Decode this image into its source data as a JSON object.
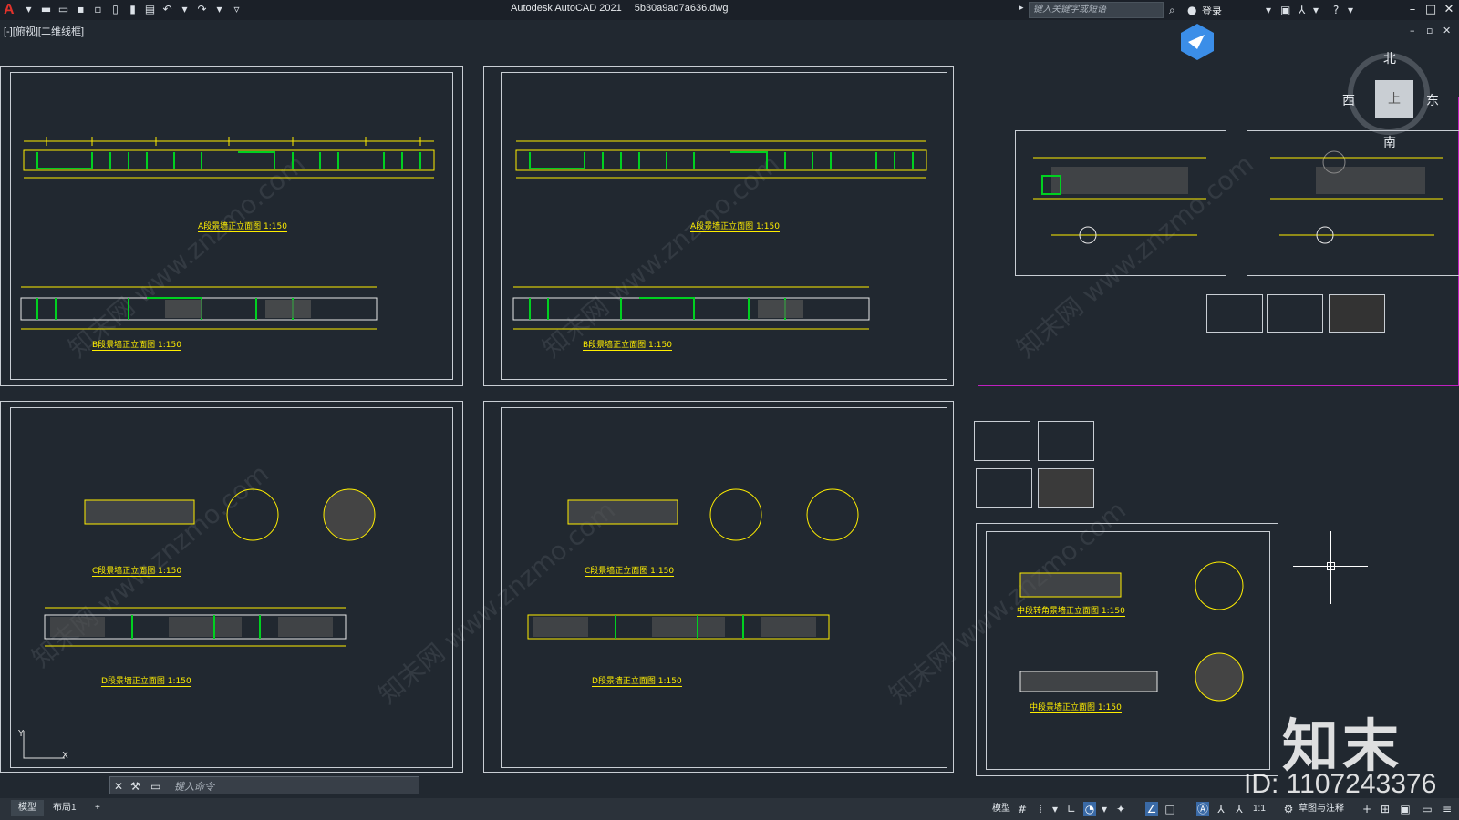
{
  "app": {
    "title": "Autodesk AutoCAD 2021",
    "filename": "5b30a9ad7a636.dwg",
    "search_placeholder": "键入关键字或短语",
    "login": "登录",
    "viewport_label": "[-][俯视][二维线框]"
  },
  "viewcube": {
    "face": "上",
    "north": "北",
    "south": "南",
    "east": "东",
    "west": "西"
  },
  "sheets": {
    "captions": [
      "A段景墙正立面图 1:150",
      "B段景墙正立面图 1:150",
      "A段景墙正立面图 1:150",
      "B段景墙正立面图 1:150",
      "C段景墙正立面图 1:150",
      "D段景墙正立面图 1:150",
      "C段景墙正立面图 1:150",
      "D段景墙正立面图 1:150",
      "中段转角景墙正立面图 1:150",
      "中段景墙正立面图 1:150"
    ]
  },
  "command": {
    "placeholder": "键入命令"
  },
  "tabs": [
    "模型",
    "布局1",
    "+"
  ],
  "status": {
    "model": "模型",
    "scale": "1:1",
    "workspace": "草图与注释"
  },
  "watermark": {
    "text": "知末网 www.znzmo.com",
    "brand": "知末",
    "id": "ID: 1107243376"
  }
}
